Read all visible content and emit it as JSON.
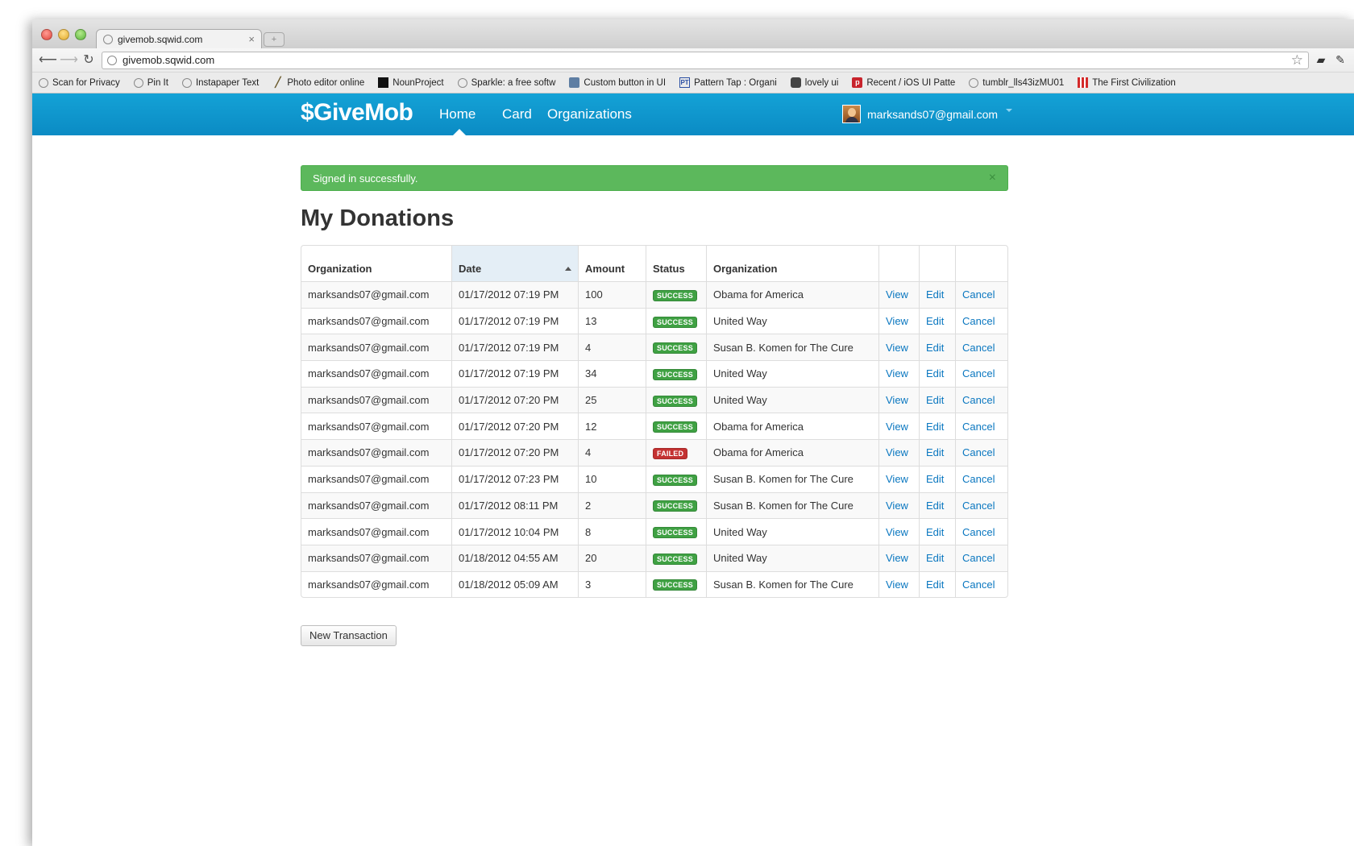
{
  "browser": {
    "tab_title": "givemob.sqwid.com",
    "url": "givemob.sqwid.com",
    "bookmarks": [
      {
        "label": "Scan for Privacy",
        "icon": "globe-icon"
      },
      {
        "label": "Pin It",
        "icon": "globe-icon"
      },
      {
        "label": "Instapaper Text",
        "icon": "globe-icon"
      },
      {
        "label": "Photo editor online",
        "icon": "pen-icon"
      },
      {
        "label": "NounProject",
        "icon": "square-icon"
      },
      {
        "label": "Sparkle: a free softw",
        "icon": "globe-icon"
      },
      {
        "label": "Custom button in UI",
        "icon": "document-icon"
      },
      {
        "label": "Pattern Tap : Organi",
        "icon": "pt-icon"
      },
      {
        "label": "lovely ui",
        "icon": "shield-icon"
      },
      {
        "label": "Recent / iOS UI Patte",
        "icon": "pinterest-icon"
      },
      {
        "label": "tumblr_lls43izMU01",
        "icon": "globe-icon"
      },
      {
        "label": "The First Civilization",
        "icon": "red-grid-icon"
      }
    ]
  },
  "navbar": {
    "brand": "$GiveMob",
    "links": [
      "Home",
      "Card",
      "Organizations"
    ],
    "active": "Home",
    "user_email": "marksands07@gmail.com"
  },
  "alert": {
    "message": "Signed in successfully.",
    "close": "×"
  },
  "page_title": "My Donations",
  "table": {
    "headers": [
      "Organization",
      "Date",
      "Amount",
      "Status",
      "Organization",
      "",
      "",
      ""
    ],
    "sorted_column": "Date",
    "rows": [
      {
        "user": "marksands07@gmail.com",
        "date": "01/17/2012 07:19 PM",
        "amount": "100",
        "status": "SUCCESS",
        "org": "Obama for America"
      },
      {
        "user": "marksands07@gmail.com",
        "date": "01/17/2012 07:19 PM",
        "amount": "13",
        "status": "SUCCESS",
        "org": "United Way"
      },
      {
        "user": "marksands07@gmail.com",
        "date": "01/17/2012 07:19 PM",
        "amount": "4",
        "status": "SUCCESS",
        "org": "Susan B. Komen for The Cure"
      },
      {
        "user": "marksands07@gmail.com",
        "date": "01/17/2012 07:19 PM",
        "amount": "34",
        "status": "SUCCESS",
        "org": "United Way"
      },
      {
        "user": "marksands07@gmail.com",
        "date": "01/17/2012 07:20 PM",
        "amount": "25",
        "status": "SUCCESS",
        "org": "United Way"
      },
      {
        "user": "marksands07@gmail.com",
        "date": "01/17/2012 07:20 PM",
        "amount": "12",
        "status": "SUCCESS",
        "org": "Obama for America"
      },
      {
        "user": "marksands07@gmail.com",
        "date": "01/17/2012 07:20 PM",
        "amount": "4",
        "status": "FAILED",
        "org": "Obama for America"
      },
      {
        "user": "marksands07@gmail.com",
        "date": "01/17/2012 07:23 PM",
        "amount": "10",
        "status": "SUCCESS",
        "org": "Susan B. Komen for The Cure"
      },
      {
        "user": "marksands07@gmail.com",
        "date": "01/17/2012 08:11 PM",
        "amount": "2",
        "status": "SUCCESS",
        "org": "Susan B. Komen for The Cure"
      },
      {
        "user": "marksands07@gmail.com",
        "date": "01/17/2012 10:04 PM",
        "amount": "8",
        "status": "SUCCESS",
        "org": "United Way"
      },
      {
        "user": "marksands07@gmail.com",
        "date": "01/18/2012 04:55 AM",
        "amount": "20",
        "status": "SUCCESS",
        "org": "United Way"
      },
      {
        "user": "marksands07@gmail.com",
        "date": "01/18/2012 05:09 AM",
        "amount": "3",
        "status": "SUCCESS",
        "org": "Susan B. Komen for The Cure"
      }
    ],
    "actions": {
      "view": "View",
      "edit": "Edit",
      "cancel": "Cancel"
    }
  },
  "new_transaction_label": "New Transaction",
  "colors": {
    "navbar": "#0b8bc4",
    "alert_success": "#5cb85c",
    "badge_success": "#3fa143",
    "badge_failed": "#c43232",
    "link": "#0a77c0"
  }
}
